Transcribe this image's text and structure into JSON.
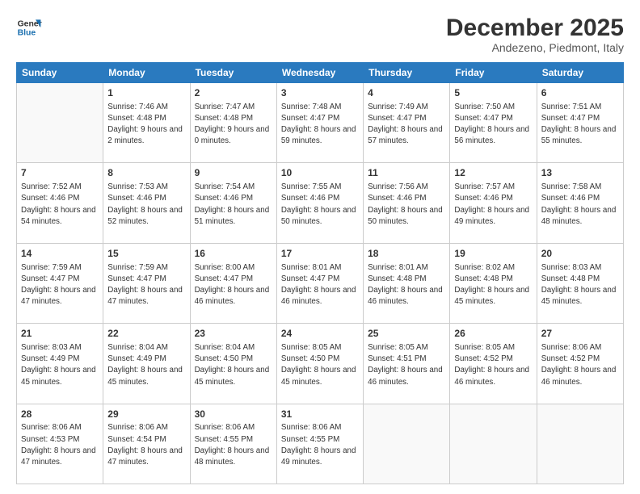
{
  "logo": {
    "line1": "General",
    "line2": "Blue"
  },
  "header": {
    "title": "December 2025",
    "subtitle": "Andezeno, Piedmont, Italy"
  },
  "weekdays": [
    "Sunday",
    "Monday",
    "Tuesday",
    "Wednesday",
    "Thursday",
    "Friday",
    "Saturday"
  ],
  "weeks": [
    [
      {
        "day": "",
        "sunrise": "",
        "sunset": "",
        "daylight": ""
      },
      {
        "day": "1",
        "sunrise": "Sunrise: 7:46 AM",
        "sunset": "Sunset: 4:48 PM",
        "daylight": "Daylight: 9 hours and 2 minutes."
      },
      {
        "day": "2",
        "sunrise": "Sunrise: 7:47 AM",
        "sunset": "Sunset: 4:48 PM",
        "daylight": "Daylight: 9 hours and 0 minutes."
      },
      {
        "day": "3",
        "sunrise": "Sunrise: 7:48 AM",
        "sunset": "Sunset: 4:47 PM",
        "daylight": "Daylight: 8 hours and 59 minutes."
      },
      {
        "day": "4",
        "sunrise": "Sunrise: 7:49 AM",
        "sunset": "Sunset: 4:47 PM",
        "daylight": "Daylight: 8 hours and 57 minutes."
      },
      {
        "day": "5",
        "sunrise": "Sunrise: 7:50 AM",
        "sunset": "Sunset: 4:47 PM",
        "daylight": "Daylight: 8 hours and 56 minutes."
      },
      {
        "day": "6",
        "sunrise": "Sunrise: 7:51 AM",
        "sunset": "Sunset: 4:47 PM",
        "daylight": "Daylight: 8 hours and 55 minutes."
      }
    ],
    [
      {
        "day": "7",
        "sunrise": "Sunrise: 7:52 AM",
        "sunset": "Sunset: 4:46 PM",
        "daylight": "Daylight: 8 hours and 54 minutes."
      },
      {
        "day": "8",
        "sunrise": "Sunrise: 7:53 AM",
        "sunset": "Sunset: 4:46 PM",
        "daylight": "Daylight: 8 hours and 52 minutes."
      },
      {
        "day": "9",
        "sunrise": "Sunrise: 7:54 AM",
        "sunset": "Sunset: 4:46 PM",
        "daylight": "Daylight: 8 hours and 51 minutes."
      },
      {
        "day": "10",
        "sunrise": "Sunrise: 7:55 AM",
        "sunset": "Sunset: 4:46 PM",
        "daylight": "Daylight: 8 hours and 50 minutes."
      },
      {
        "day": "11",
        "sunrise": "Sunrise: 7:56 AM",
        "sunset": "Sunset: 4:46 PM",
        "daylight": "Daylight: 8 hours and 50 minutes."
      },
      {
        "day": "12",
        "sunrise": "Sunrise: 7:57 AM",
        "sunset": "Sunset: 4:46 PM",
        "daylight": "Daylight: 8 hours and 49 minutes."
      },
      {
        "day": "13",
        "sunrise": "Sunrise: 7:58 AM",
        "sunset": "Sunset: 4:46 PM",
        "daylight": "Daylight: 8 hours and 48 minutes."
      }
    ],
    [
      {
        "day": "14",
        "sunrise": "Sunrise: 7:59 AM",
        "sunset": "Sunset: 4:47 PM",
        "daylight": "Daylight: 8 hours and 47 minutes."
      },
      {
        "day": "15",
        "sunrise": "Sunrise: 7:59 AM",
        "sunset": "Sunset: 4:47 PM",
        "daylight": "Daylight: 8 hours and 47 minutes."
      },
      {
        "day": "16",
        "sunrise": "Sunrise: 8:00 AM",
        "sunset": "Sunset: 4:47 PM",
        "daylight": "Daylight: 8 hours and 46 minutes."
      },
      {
        "day": "17",
        "sunrise": "Sunrise: 8:01 AM",
        "sunset": "Sunset: 4:47 PM",
        "daylight": "Daylight: 8 hours and 46 minutes."
      },
      {
        "day": "18",
        "sunrise": "Sunrise: 8:01 AM",
        "sunset": "Sunset: 4:48 PM",
        "daylight": "Daylight: 8 hours and 46 minutes."
      },
      {
        "day": "19",
        "sunrise": "Sunrise: 8:02 AM",
        "sunset": "Sunset: 4:48 PM",
        "daylight": "Daylight: 8 hours and 45 minutes."
      },
      {
        "day": "20",
        "sunrise": "Sunrise: 8:03 AM",
        "sunset": "Sunset: 4:48 PM",
        "daylight": "Daylight: 8 hours and 45 minutes."
      }
    ],
    [
      {
        "day": "21",
        "sunrise": "Sunrise: 8:03 AM",
        "sunset": "Sunset: 4:49 PM",
        "daylight": "Daylight: 8 hours and 45 minutes."
      },
      {
        "day": "22",
        "sunrise": "Sunrise: 8:04 AM",
        "sunset": "Sunset: 4:49 PM",
        "daylight": "Daylight: 8 hours and 45 minutes."
      },
      {
        "day": "23",
        "sunrise": "Sunrise: 8:04 AM",
        "sunset": "Sunset: 4:50 PM",
        "daylight": "Daylight: 8 hours and 45 minutes."
      },
      {
        "day": "24",
        "sunrise": "Sunrise: 8:05 AM",
        "sunset": "Sunset: 4:50 PM",
        "daylight": "Daylight: 8 hours and 45 minutes."
      },
      {
        "day": "25",
        "sunrise": "Sunrise: 8:05 AM",
        "sunset": "Sunset: 4:51 PM",
        "daylight": "Daylight: 8 hours and 46 minutes."
      },
      {
        "day": "26",
        "sunrise": "Sunrise: 8:05 AM",
        "sunset": "Sunset: 4:52 PM",
        "daylight": "Daylight: 8 hours and 46 minutes."
      },
      {
        "day": "27",
        "sunrise": "Sunrise: 8:06 AM",
        "sunset": "Sunset: 4:52 PM",
        "daylight": "Daylight: 8 hours and 46 minutes."
      }
    ],
    [
      {
        "day": "28",
        "sunrise": "Sunrise: 8:06 AM",
        "sunset": "Sunset: 4:53 PM",
        "daylight": "Daylight: 8 hours and 47 minutes."
      },
      {
        "day": "29",
        "sunrise": "Sunrise: 8:06 AM",
        "sunset": "Sunset: 4:54 PM",
        "daylight": "Daylight: 8 hours and 47 minutes."
      },
      {
        "day": "30",
        "sunrise": "Sunrise: 8:06 AM",
        "sunset": "Sunset: 4:55 PM",
        "daylight": "Daylight: 8 hours and 48 minutes."
      },
      {
        "day": "31",
        "sunrise": "Sunrise: 8:06 AM",
        "sunset": "Sunset: 4:55 PM",
        "daylight": "Daylight: 8 hours and 49 minutes."
      },
      {
        "day": "",
        "sunrise": "",
        "sunset": "",
        "daylight": ""
      },
      {
        "day": "",
        "sunrise": "",
        "sunset": "",
        "daylight": ""
      },
      {
        "day": "",
        "sunrise": "",
        "sunset": "",
        "daylight": ""
      }
    ]
  ]
}
